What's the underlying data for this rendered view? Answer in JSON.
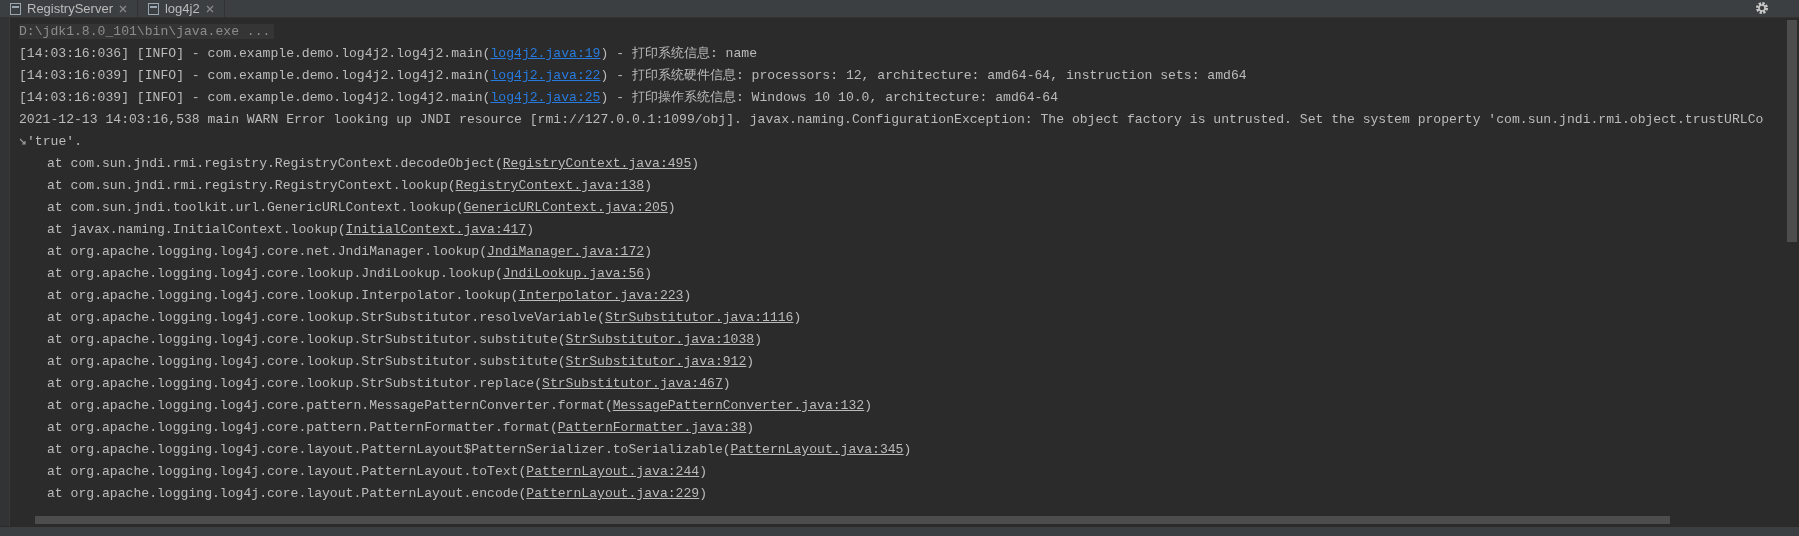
{
  "tabs": [
    {
      "label": "RegistryServer"
    },
    {
      "label": "log4j2"
    }
  ],
  "command": "D:\\jdk1.8.0_101\\bin\\java.exe ...",
  "lines": [
    {
      "kind": "info",
      "text": "[14:03:16:036] [INFO] - com.example.demo.log4j2.log4j2.main(",
      "link": "log4j2.java:19",
      "after": ") - 打印系统信息: name"
    },
    {
      "kind": "info",
      "text": "[14:03:16:039] [INFO] - com.example.demo.log4j2.log4j2.main(",
      "link": "log4j2.java:22",
      "after": ") - 打印系统硬件信息: processors: 12, architecture: amd64-64, instruction sets: amd64"
    },
    {
      "kind": "info",
      "text": "[14:03:16:039] [INFO] - com.example.demo.log4j2.log4j2.main(",
      "link": "log4j2.java:25",
      "after": ") - 打印操作系统信息: Windows 10 10.0, architecture: amd64-64"
    },
    {
      "kind": "plain",
      "text": "2021-12-13 14:03:16,538 main WARN Error looking up JNDI resource [rmi://127.0.0.1:1099/obj]. javax.naming.ConfigurationException: The object factory is untrusted. Set the system property 'com.sun.jndi.rmi.object.trustURLCo"
    },
    {
      "kind": "wrap",
      "text": "'true'."
    },
    {
      "kind": "at",
      "text": "at com.sun.jndi.rmi.registry.RegistryContext.decodeObject(",
      "link": "RegistryContext.java:495",
      "after": ")"
    },
    {
      "kind": "at",
      "text": "at com.sun.jndi.rmi.registry.RegistryContext.lookup(",
      "link": "RegistryContext.java:138",
      "after": ")"
    },
    {
      "kind": "at",
      "text": "at com.sun.jndi.toolkit.url.GenericURLContext.lookup(",
      "link": "GenericURLContext.java:205",
      "after": ")"
    },
    {
      "kind": "at",
      "text": "at javax.naming.InitialContext.lookup(",
      "link": "InitialContext.java:417",
      "after": ")"
    },
    {
      "kind": "at",
      "text": "at org.apache.logging.log4j.core.net.JndiManager.lookup(",
      "link": "JndiManager.java:172",
      "after": ")"
    },
    {
      "kind": "at",
      "text": "at org.apache.logging.log4j.core.lookup.JndiLookup.lookup(",
      "link": "JndiLookup.java:56",
      "after": ")"
    },
    {
      "kind": "at",
      "text": "at org.apache.logging.log4j.core.lookup.Interpolator.lookup(",
      "link": "Interpolator.java:223",
      "after": ")"
    },
    {
      "kind": "at",
      "text": "at org.apache.logging.log4j.core.lookup.StrSubstitutor.resolveVariable(",
      "link": "StrSubstitutor.java:1116",
      "after": ")"
    },
    {
      "kind": "at",
      "text": "at org.apache.logging.log4j.core.lookup.StrSubstitutor.substitute(",
      "link": "StrSubstitutor.java:1038",
      "after": ")"
    },
    {
      "kind": "at",
      "text": "at org.apache.logging.log4j.core.lookup.StrSubstitutor.substitute(",
      "link": "StrSubstitutor.java:912",
      "after": ")"
    },
    {
      "kind": "at",
      "text": "at org.apache.logging.log4j.core.lookup.StrSubstitutor.replace(",
      "link": "StrSubstitutor.java:467",
      "after": ")"
    },
    {
      "kind": "at",
      "text": "at org.apache.logging.log4j.core.pattern.MessagePatternConverter.format(",
      "link": "MessagePatternConverter.java:132",
      "after": ")"
    },
    {
      "kind": "at",
      "text": "at org.apache.logging.log4j.core.pattern.PatternFormatter.format(",
      "link": "PatternFormatter.java:38",
      "after": ")"
    },
    {
      "kind": "at",
      "text": "at org.apache.logging.log4j.core.layout.PatternLayout$PatternSerializer.toSerializable(",
      "link": "PatternLayout.java:345",
      "after": ")"
    },
    {
      "kind": "at",
      "text": "at org.apache.logging.log4j.core.layout.PatternLayout.toText(",
      "link": "PatternLayout.java:244",
      "after": ")"
    },
    {
      "kind": "at",
      "text": "at org.apache.logging.log4j.core.layout.PatternLayout.encode(",
      "link": "PatternLayout.java:229",
      "after": ")"
    }
  ]
}
